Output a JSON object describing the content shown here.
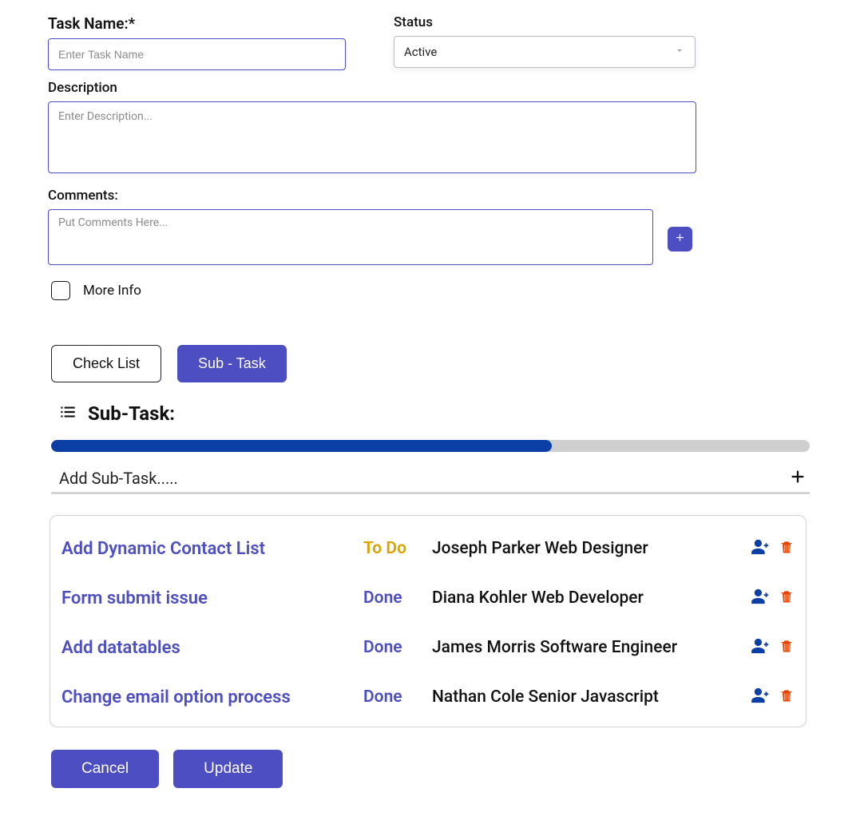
{
  "form": {
    "task_name_label": "Task Name:*",
    "task_name_placeholder": "Enter Task Name",
    "status_label": "Status",
    "status_value": "Active",
    "description_label": "Description",
    "description_placeholder": "Enter Description...",
    "comments_label": "Comments:",
    "comments_placeholder": "Put Comments Here...",
    "more_info_label": "More Info"
  },
  "tabs": {
    "checklist": "Check List",
    "subtask": "Sub - Task"
  },
  "subtask": {
    "title": "Sub-Task:",
    "progress_percent": 66,
    "add_placeholder": "Add Sub-Task.....",
    "items": [
      {
        "name": "Add Dynamic Contact List",
        "status": "To Do",
        "status_class": "st-todo",
        "person": "Joseph Parker Web Designer"
      },
      {
        "name": "Form submit issue",
        "status": "Done",
        "status_class": "st-done",
        "person": "Diana Kohler Web Developer"
      },
      {
        "name": "Add datatables",
        "status": "Done",
        "status_class": "st-done",
        "person": "James Morris Software Engineer"
      },
      {
        "name": "Change email option process",
        "status": "Done",
        "status_class": "st-done",
        "person": "Nathan Cole Senior Javascript"
      }
    ]
  },
  "footer": {
    "cancel": "Cancel",
    "update": "Update"
  }
}
